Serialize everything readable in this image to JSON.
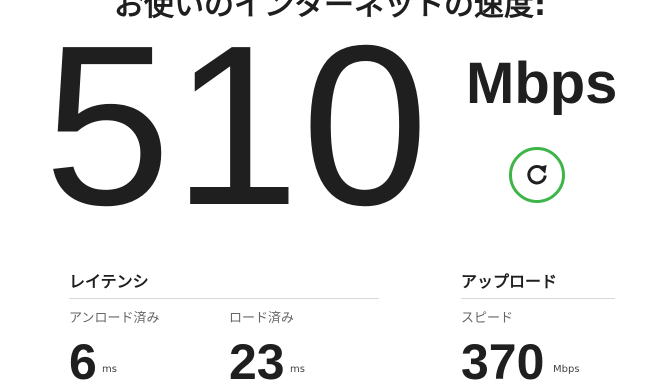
{
  "title": "お使いのインターネットの速度:",
  "speed": {
    "value": "510",
    "unit": "Mbps"
  },
  "refresh": {
    "icon": "refresh-icon",
    "color": "#3db549"
  },
  "latency": {
    "heading": "レイテンシ",
    "unloaded": {
      "label": "アンロード済み",
      "value": "6",
      "unit": "ms"
    },
    "loaded": {
      "label": "ロード済み",
      "value": "23",
      "unit": "ms"
    }
  },
  "upload": {
    "heading": "アップロード",
    "speed": {
      "label": "スピード",
      "value": "370",
      "unit": "Mbps"
    }
  }
}
